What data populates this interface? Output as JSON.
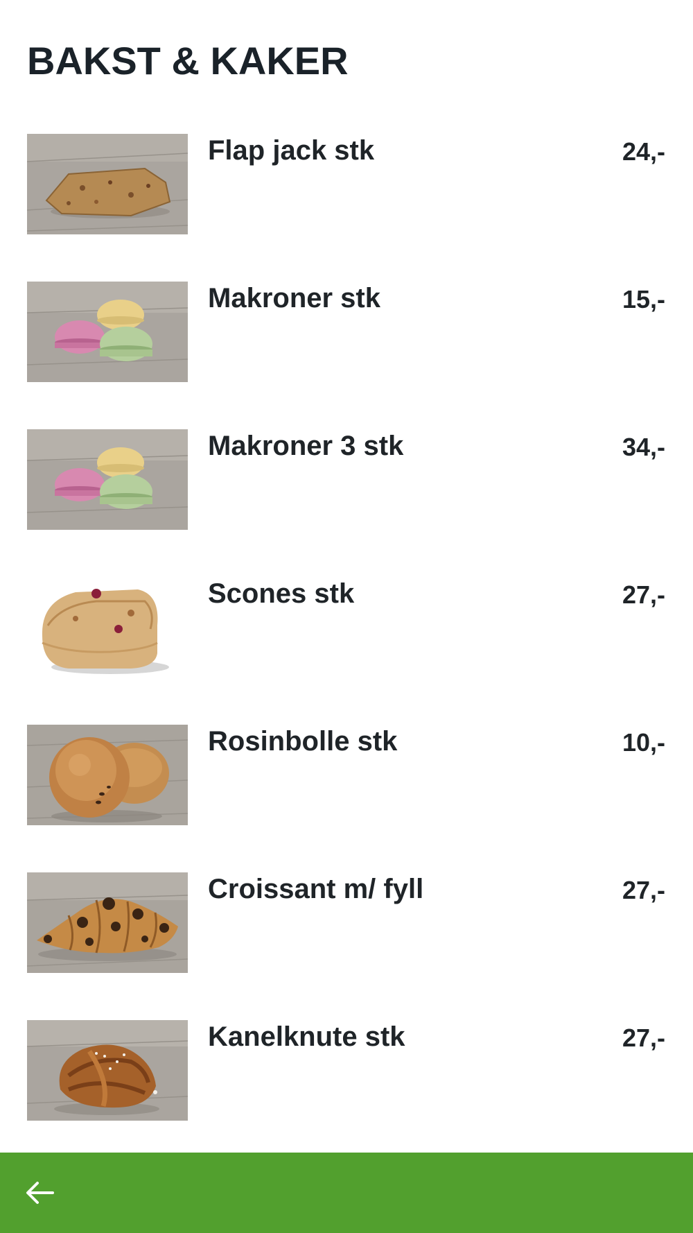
{
  "page": {
    "title": "BAKST & KAKER"
  },
  "products": [
    {
      "name": "Flap jack stk",
      "price": "24,-",
      "image": "flapjack"
    },
    {
      "name": "Makroner stk",
      "price": "15,-",
      "image": "macarons"
    },
    {
      "name": "Makroner 3 stk",
      "price": "34,-",
      "image": "macarons"
    },
    {
      "name": "Scones stk",
      "price": "27,-",
      "image": "scone"
    },
    {
      "name": "Rosinbolle stk",
      "price": "10,-",
      "image": "raisin-bun"
    },
    {
      "name": "Croissant m/ fyll",
      "price": "27,-",
      "image": "croissant"
    },
    {
      "name": "Kanelknute stk",
      "price": "27,-",
      "image": "cinnamon-knot"
    }
  ],
  "bottom_bar": {
    "back_icon": "arrow-left-icon",
    "background_color": "#52a02e"
  }
}
